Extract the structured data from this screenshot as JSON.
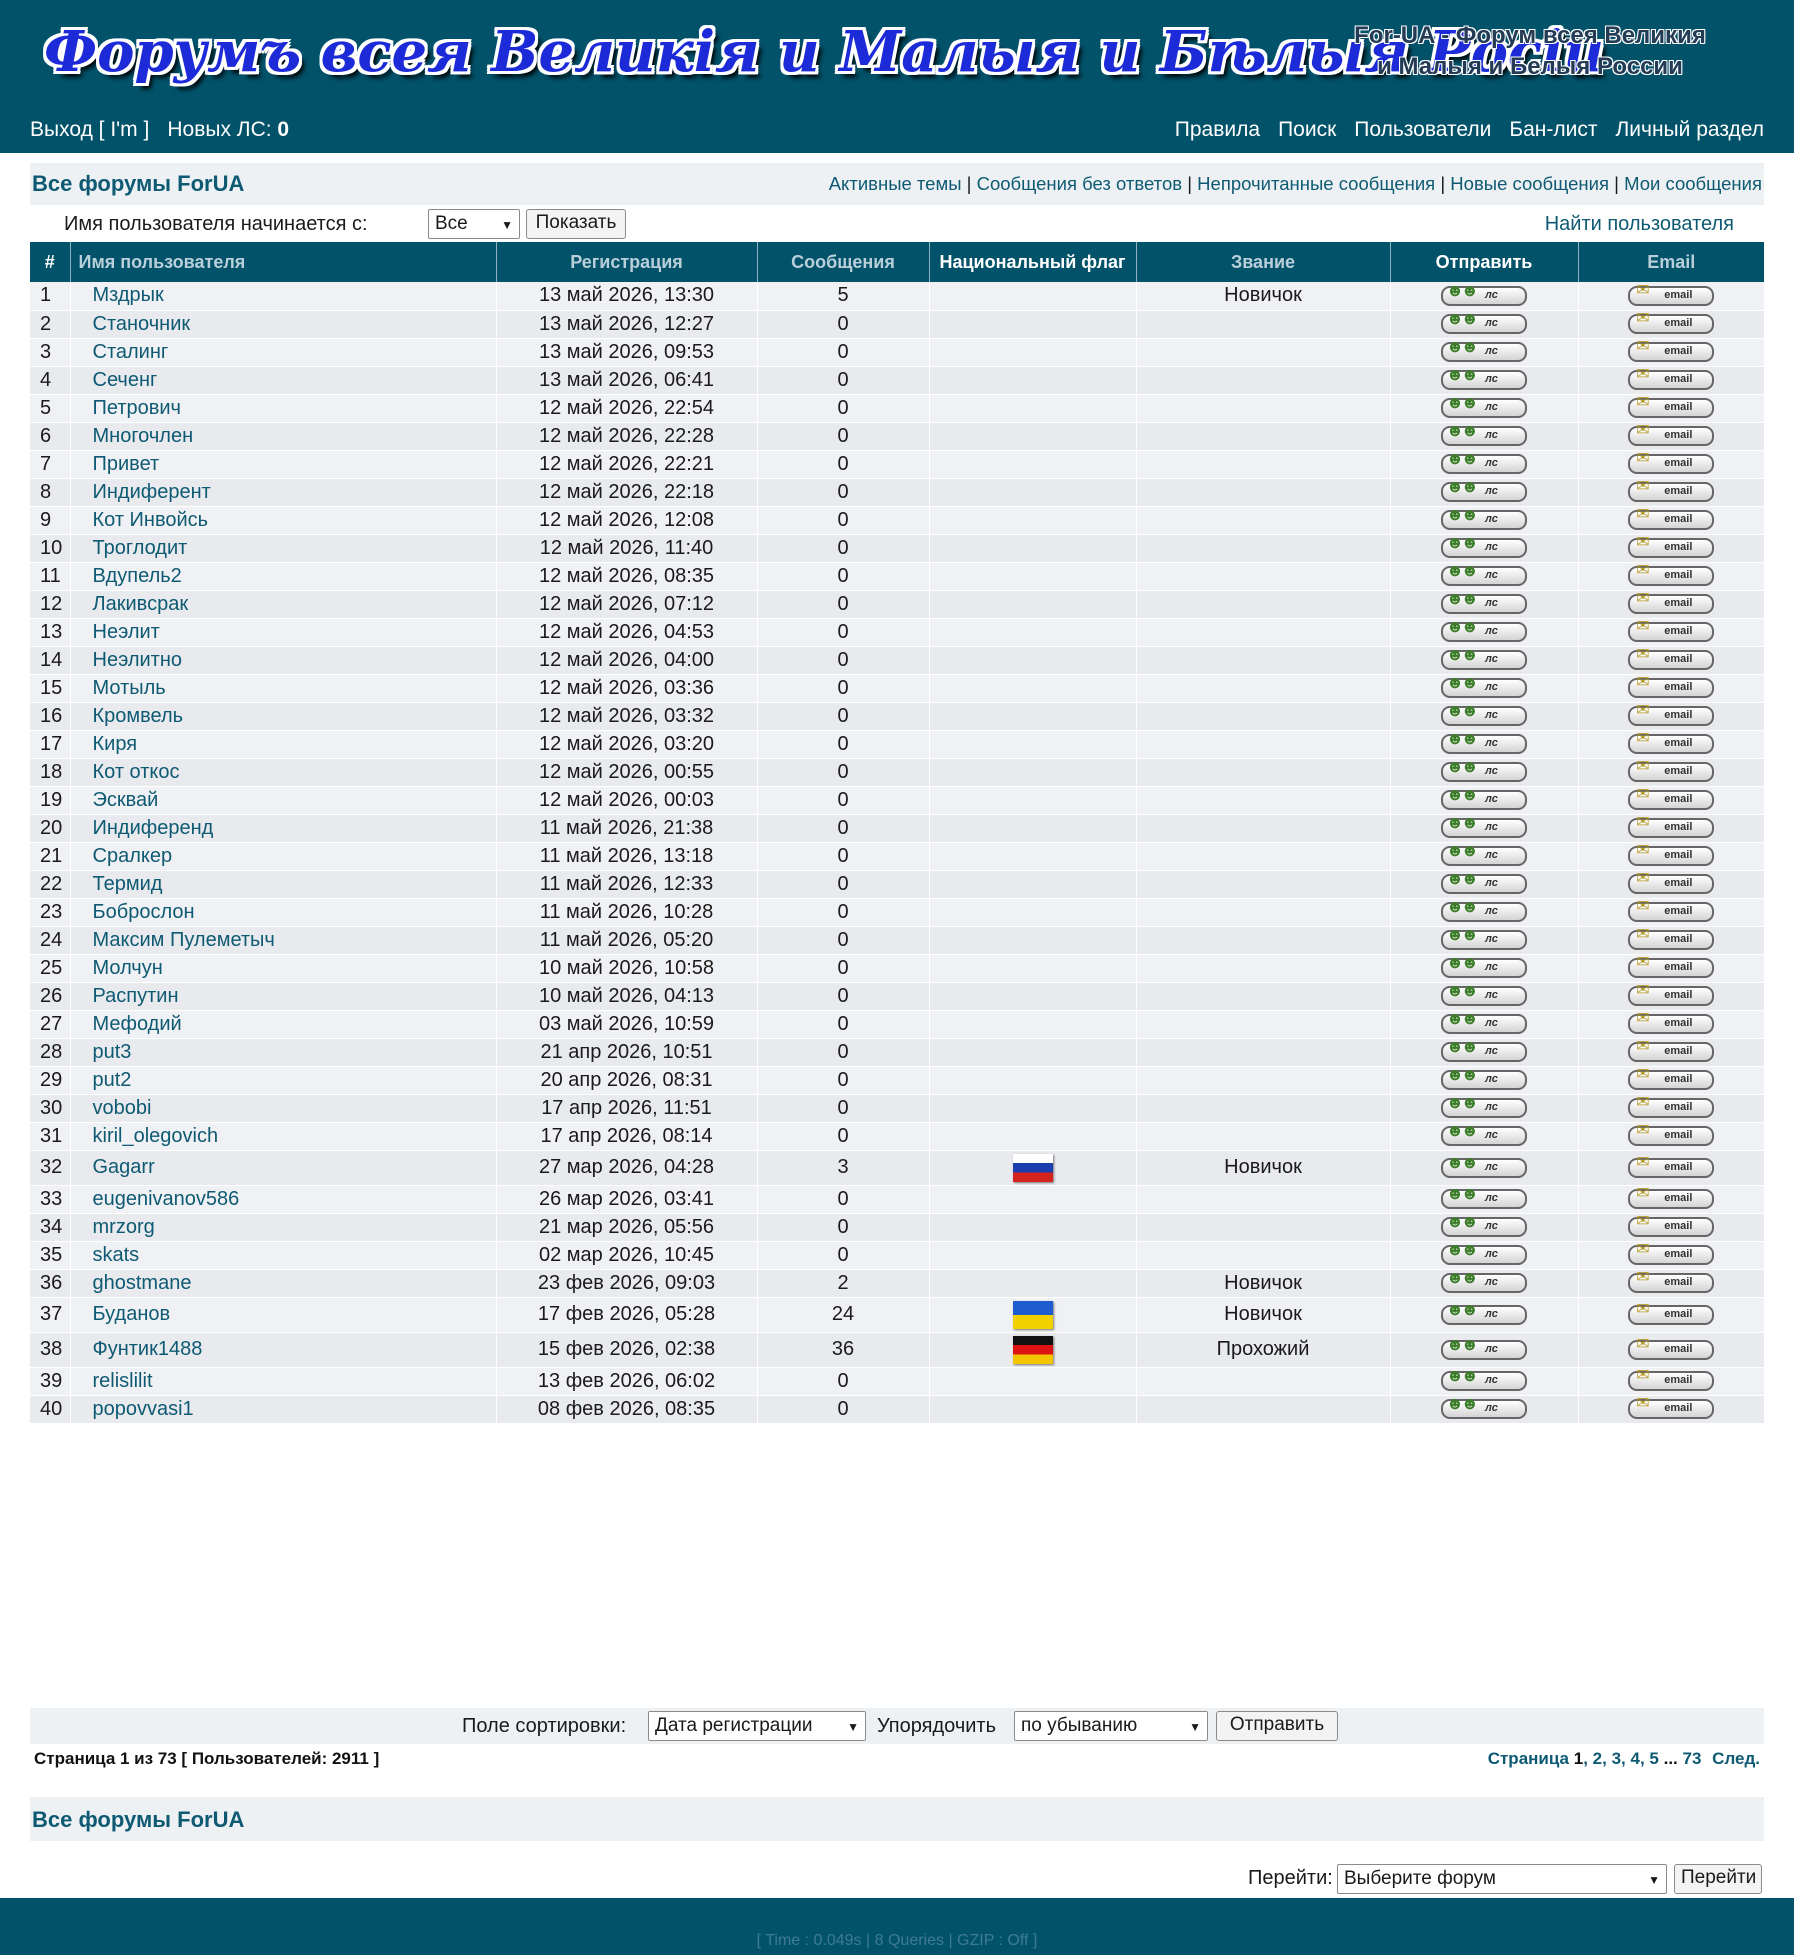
{
  "header": {
    "logo_text": "Форумъ всея Великія и Малыя и Бѣлыя Росіи",
    "site_desc_line1": "For-UA - Форум всея Великия",
    "site_desc_line2": "и Малыя и Белыя России",
    "logout": "Выход [ I'm ]",
    "new_pm_label": "Новых ЛС:",
    "new_pm_count": "0",
    "nav": [
      "Правила",
      "Поиск",
      "Пользователи",
      "Бан-лист",
      "Личный раздел"
    ]
  },
  "navbar": {
    "title": "Все форумы ForUA",
    "links": [
      "Активные темы",
      "Сообщения без ответов",
      "Непрочитанные сообщения",
      "Новые сообщения",
      "Мои сообщения"
    ]
  },
  "filter": {
    "label": "Имя пользователя начинается с:",
    "select_value": "Все",
    "show_button": "Показать",
    "find_user": "Найти пользователя"
  },
  "table": {
    "headers": [
      "#",
      "Имя пользователя",
      "Регистрация",
      "Сообщения",
      "Национальный флаг",
      "Звание",
      "Отправить",
      "Email"
    ],
    "pm_label": "лс",
    "email_label": "email",
    "rows": [
      {
        "n": "1",
        "name": "Мздрык",
        "reg": "13 май 2026, 13:30",
        "posts": "5",
        "flag": "",
        "rank": "Новичок"
      },
      {
        "n": "2",
        "name": "Станочник",
        "reg": "13 май 2026, 12:27",
        "posts": "0",
        "flag": "",
        "rank": ""
      },
      {
        "n": "3",
        "name": "Сталинг",
        "reg": "13 май 2026, 09:53",
        "posts": "0",
        "flag": "",
        "rank": ""
      },
      {
        "n": "4",
        "name": "Сеченг",
        "reg": "13 май 2026, 06:41",
        "posts": "0",
        "flag": "",
        "rank": ""
      },
      {
        "n": "5",
        "name": "Петрович",
        "reg": "12 май 2026, 22:54",
        "posts": "0",
        "flag": "",
        "rank": ""
      },
      {
        "n": "6",
        "name": "Многочлен",
        "reg": "12 май 2026, 22:28",
        "posts": "0",
        "flag": "",
        "rank": ""
      },
      {
        "n": "7",
        "name": "Привет",
        "reg": "12 май 2026, 22:21",
        "posts": "0",
        "flag": "",
        "rank": ""
      },
      {
        "n": "8",
        "name": "Индиферент",
        "reg": "12 май 2026, 22:18",
        "posts": "0",
        "flag": "",
        "rank": ""
      },
      {
        "n": "9",
        "name": "Кот Инвойсь",
        "reg": "12 май 2026, 12:08",
        "posts": "0",
        "flag": "",
        "rank": ""
      },
      {
        "n": "10",
        "name": "Троглодит",
        "reg": "12 май 2026, 11:40",
        "posts": "0",
        "flag": "",
        "rank": ""
      },
      {
        "n": "11",
        "name": "Вдупель2",
        "reg": "12 май 2026, 08:35",
        "posts": "0",
        "flag": "",
        "rank": ""
      },
      {
        "n": "12",
        "name": "Лакивсрак",
        "reg": "12 май 2026, 07:12",
        "posts": "0",
        "flag": "",
        "rank": ""
      },
      {
        "n": "13",
        "name": "Неэлит",
        "reg": "12 май 2026, 04:53",
        "posts": "0",
        "flag": "",
        "rank": ""
      },
      {
        "n": "14",
        "name": "Неэлитно",
        "reg": "12 май 2026, 04:00",
        "posts": "0",
        "flag": "",
        "rank": ""
      },
      {
        "n": "15",
        "name": "Мотыль",
        "reg": "12 май 2026, 03:36",
        "posts": "0",
        "flag": "",
        "rank": ""
      },
      {
        "n": "16",
        "name": "Кромвель",
        "reg": "12 май 2026, 03:32",
        "posts": "0",
        "flag": "",
        "rank": ""
      },
      {
        "n": "17",
        "name": "Киря",
        "reg": "12 май 2026, 03:20",
        "posts": "0",
        "flag": "",
        "rank": ""
      },
      {
        "n": "18",
        "name": "Кот откос",
        "reg": "12 май 2026, 00:55",
        "posts": "0",
        "flag": "",
        "rank": ""
      },
      {
        "n": "19",
        "name": "Эсквай",
        "reg": "12 май 2026, 00:03",
        "posts": "0",
        "flag": "",
        "rank": ""
      },
      {
        "n": "20",
        "name": "Индиференд",
        "reg": "11 май 2026, 21:38",
        "posts": "0",
        "flag": "",
        "rank": ""
      },
      {
        "n": "21",
        "name": "Сралкер",
        "reg": "11 май 2026, 13:18",
        "posts": "0",
        "flag": "",
        "rank": ""
      },
      {
        "n": "22",
        "name": "Термид",
        "reg": "11 май 2026, 12:33",
        "posts": "0",
        "flag": "",
        "rank": ""
      },
      {
        "n": "23",
        "name": "Бобрoслон",
        "reg": "11 май 2026, 10:28",
        "posts": "0",
        "flag": "",
        "rank": ""
      },
      {
        "n": "24",
        "name": "Максим Пулеметыч",
        "reg": "11 май 2026, 05:20",
        "posts": "0",
        "flag": "",
        "rank": ""
      },
      {
        "n": "25",
        "name": "Молчун",
        "reg": "10 май 2026, 10:58",
        "posts": "0",
        "flag": "",
        "rank": ""
      },
      {
        "n": "26",
        "name": "Распутин",
        "reg": "10 май 2026, 04:13",
        "posts": "0",
        "flag": "",
        "rank": ""
      },
      {
        "n": "27",
        "name": "Мефодий",
        "reg": "03 май 2026, 10:59",
        "posts": "0",
        "flag": "",
        "rank": ""
      },
      {
        "n": "28",
        "name": "put3",
        "reg": "21 апр 2026, 10:51",
        "posts": "0",
        "flag": "",
        "rank": ""
      },
      {
        "n": "29",
        "name": "put2",
        "reg": "20 апр 2026, 08:31",
        "posts": "0",
        "flag": "",
        "rank": ""
      },
      {
        "n": "30",
        "name": "vobobi",
        "reg": "17 апр 2026, 11:51",
        "posts": "0",
        "flag": "",
        "rank": ""
      },
      {
        "n": "31",
        "name": "kiril_olegovich",
        "reg": "17 апр 2026, 08:14",
        "posts": "0",
        "flag": "",
        "rank": ""
      },
      {
        "n": "32",
        "name": "Gagarr",
        "reg": "27 мар 2026, 04:28",
        "posts": "3",
        "flag": "ru",
        "rank": "Новичок"
      },
      {
        "n": "33",
        "name": "eugenivanov586",
        "reg": "26 мар 2026, 03:41",
        "posts": "0",
        "flag": "",
        "rank": ""
      },
      {
        "n": "34",
        "name": "mrzorg",
        "reg": "21 мар 2026, 05:56",
        "posts": "0",
        "flag": "",
        "rank": ""
      },
      {
        "n": "35",
        "name": "skats",
        "reg": "02 мар 2026, 10:45",
        "posts": "0",
        "flag": "",
        "rank": ""
      },
      {
        "n": "36",
        "name": "ghostmane",
        "reg": "23 фев 2026, 09:03",
        "posts": "2",
        "flag": "",
        "rank": "Новичок"
      },
      {
        "n": "37",
        "name": "Буданов",
        "reg": "17 фев 2026, 05:28",
        "posts": "24",
        "flag": "ua",
        "rank": "Новичок"
      },
      {
        "n": "38",
        "name": "Фунтик1488",
        "reg": "15 фев 2026, 02:38",
        "posts": "36",
        "flag": "de",
        "rank": "Прохожий"
      },
      {
        "n": "39",
        "name": "relislilit",
        "reg": "13 фев 2026, 06:02",
        "posts": "0",
        "flag": "",
        "rank": ""
      },
      {
        "n": "40",
        "name": "popovvasi1",
        "reg": "08 фев 2026, 08:35",
        "posts": "0",
        "flag": "",
        "rank": ""
      }
    ]
  },
  "sort": {
    "field_label": "Поле сортировки:",
    "field_value": "Дата регистрации",
    "order_label": "Упорядочить",
    "order_value": "по убыванию",
    "submit": "Отправить"
  },
  "pagination": {
    "info": "Страница 1 из 73 [ Пользователей: 2911 ]",
    "label": "Страница",
    "current": "1",
    "pages": [
      "2",
      "3",
      "4",
      "5"
    ],
    "ellipsis": "...",
    "last": "73",
    "next": "След."
  },
  "bottom": {
    "title": "Все форумы ForUA",
    "jump_label": "Перейти:",
    "jump_select": "Выберите форум",
    "jump_button": "Перейти"
  },
  "footer": {
    "stats": "[ Time : 0.049s | 8 Queries | GZIP : Off ]"
  }
}
